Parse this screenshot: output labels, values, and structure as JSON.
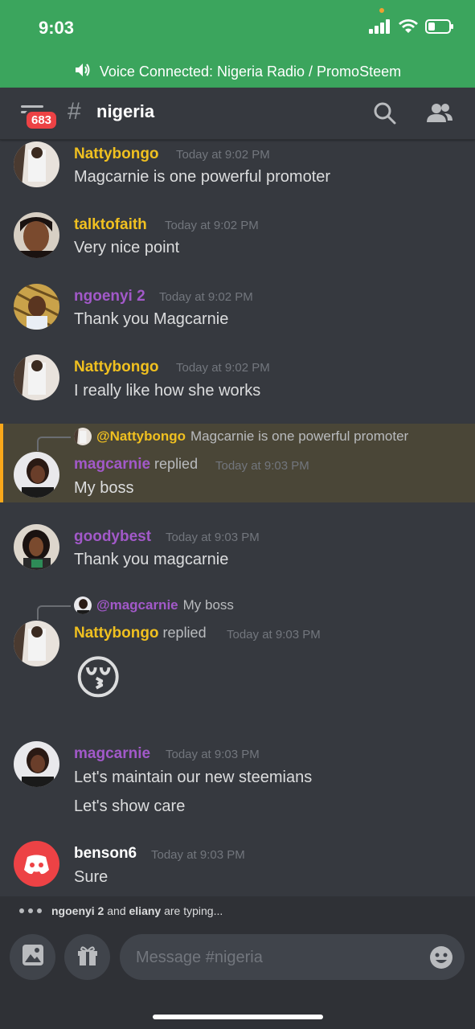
{
  "status_bar": {
    "time": "9:03"
  },
  "voice": {
    "label": "Voice Connected: Nigeria Radio / PromoSteem"
  },
  "header": {
    "badge": "683",
    "hash": "#",
    "channel": "nigeria"
  },
  "colors": {
    "gold": "#f0c020",
    "purple": "#a259c9",
    "white": "#ffffff",
    "green": "#3ba55d",
    "red": "#ed4245"
  },
  "messages": [
    {
      "author": "Nattybongo",
      "time": "Today at 9:02 PM",
      "text": "Magcarnie is one powerful promoter"
    },
    {
      "author": "talktofaith",
      "time": "Today at 9:02 PM",
      "text": "Very nice point"
    },
    {
      "author": "ngoenyi 2",
      "time": "Today at 9:02 PM",
      "text": "Thank you Magcarnie"
    },
    {
      "author": "Nattybongo",
      "time": "Today at 9:02 PM",
      "text": "I really like how she works"
    },
    {
      "reply_to": "@Nattybongo",
      "reply_text": "Magcarnie is one powerful promoter",
      "author": "magcarnie",
      "replied": "replied",
      "time": "Today at 9:03 PM",
      "text": "My boss"
    },
    {
      "author": "goodybest",
      "time": "Today at 9:03 PM",
      "text": "Thank you magcarnie"
    },
    {
      "reply_to": "@magcarnie",
      "reply_text": "My boss",
      "author": "Nattybongo",
      "replied": "replied",
      "time": "Today at 9:03 PM",
      "text": "😚"
    },
    {
      "author": "magcarnie",
      "time": "Today at 9:03 PM",
      "text": "Let's maintain our new steemians",
      "text2": "Let's show care"
    },
    {
      "author": "benson6",
      "time": "Today at 9:03 PM",
      "text": "Sure"
    }
  ],
  "typing": {
    "users": "ngoenyi 2",
    "conj": "and",
    "users2": "eliany",
    "suffix": "are typing..."
  },
  "input": {
    "placeholder": "Message #nigeria"
  }
}
